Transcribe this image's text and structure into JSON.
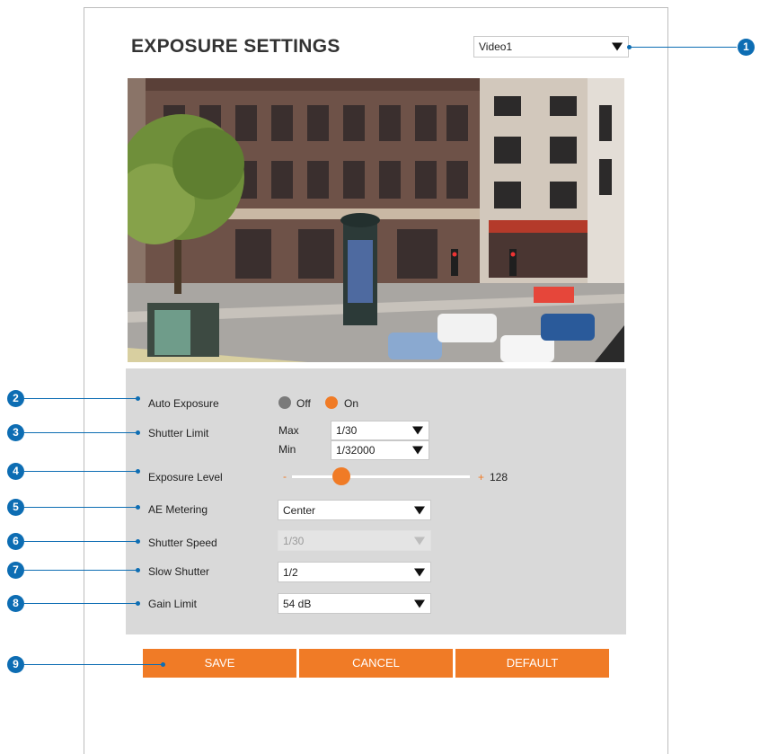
{
  "header": {
    "title": "EXPOSURE SETTINGS"
  },
  "video_select": {
    "value": "Video1"
  },
  "callouts": [
    "1",
    "2",
    "3",
    "4",
    "5",
    "6",
    "7",
    "8",
    "9"
  ],
  "settings": {
    "auto_exposure": {
      "label": "Auto Exposure",
      "off": "Off",
      "on": "On",
      "selected": "On"
    },
    "shutter_limit": {
      "label": "Shutter Limit",
      "max_label": "Max",
      "max_value": "1/30",
      "min_label": "Min",
      "min_value": "1/32000"
    },
    "exposure_level": {
      "label": "Exposure Level",
      "minus": "-",
      "plus": "+",
      "value": "128",
      "fraction": 0.28
    },
    "ae_metering": {
      "label": "AE Metering",
      "value": "Center"
    },
    "shutter_speed": {
      "label": "Shutter Speed",
      "value": "1/30"
    },
    "slow_shutter": {
      "label": "Slow Shutter",
      "value": "1/2"
    },
    "gain_limit": {
      "label": "Gain Limit",
      "value": "54 dB"
    }
  },
  "buttons": {
    "save": "SAVE",
    "cancel": "CANCEL",
    "default": "DEFAULT"
  },
  "colors": {
    "accent": "#f07b26",
    "callout": "#0d6db3",
    "panel": "#d9d9d9",
    "radio_off": "#7a7a7a"
  }
}
